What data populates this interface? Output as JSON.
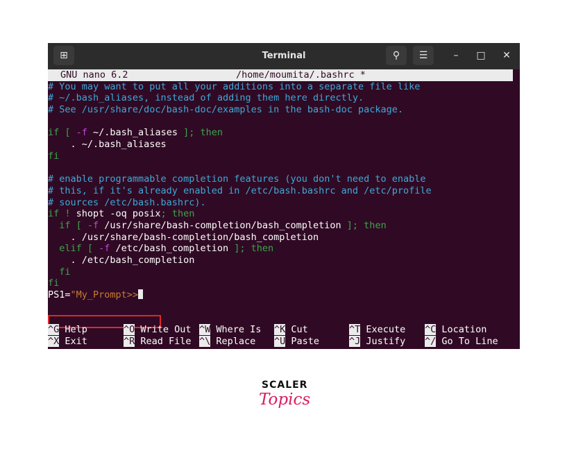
{
  "window": {
    "title": "Terminal",
    "icons": {
      "new_tab": "new-tab-icon",
      "search": "search-icon",
      "menu": "hamburger-menu-icon",
      "minimize": "minimize-icon",
      "maximize": "maximize-icon",
      "close": "close-icon"
    },
    "glyphs": {
      "new_tab": "⊞",
      "search": "⚲",
      "menu": "☰",
      "minimize": "–",
      "maximize": "□",
      "close": "✕"
    }
  },
  "nano": {
    "version": "GNU nano 6.2",
    "file": "/home/moumita/.bashrc *"
  },
  "editor": {
    "l1": "# You may want to put all your additions into a separate file like",
    "l2": "# ~/.bash_aliases, instead of adding them here directly.",
    "l3": "# See /usr/share/doc/bash-doc/examples in the bash-doc package.",
    "l5_if": "if [ ",
    "l5_flag": "-f",
    "l5_path": " ~/.bash_aliases",
    "l5_end": " ]; then",
    "l6": "    . ~/.bash_aliases",
    "l7": "fi",
    "l9": "# enable programmable completion features (you don't need to enable",
    "l10": "# this, if it's already enabled in /etc/bash.bashrc and /etc/profile",
    "l11": "# sources /etc/bash.bashrc).",
    "l12_if": "if ! ",
    "l12_cmd": "shopt -oq posix",
    "l12_then": "; then",
    "l13_if": "  if [ ",
    "l13_flag": "-f",
    "l13_path": " /usr/share/bash-completion/bash_completion",
    "l13_end": " ]; then",
    "l14": "    . /usr/share/bash-completion/bash_completion",
    "l15_elif": "  elif [ ",
    "l15_flag": "-f",
    "l15_path": " /etc/bash_completion",
    "l15_end": " ]; then",
    "l16": "    . /etc/bash_completion",
    "l17": "  fi",
    "l18": "fi",
    "ps1_var": "PS1",
    "ps1_eq": "=",
    "ps1_val": "\"My_Prompt>>"
  },
  "shortcuts": {
    "row1": [
      {
        "key": "^G",
        "label": " Help"
      },
      {
        "key": "^O",
        "label": " Write Out"
      },
      {
        "key": "^W",
        "label": " Where Is"
      },
      {
        "key": "^K",
        "label": " Cut"
      },
      {
        "key": "^T",
        "label": " Execute"
      },
      {
        "key": "^C",
        "label": " Location"
      }
    ],
    "row2": [
      {
        "key": "^X",
        "label": " Exit"
      },
      {
        "key": "^R",
        "label": " Read File"
      },
      {
        "key": "^\\",
        "label": " Replace"
      },
      {
        "key": "^U",
        "label": " Paste"
      },
      {
        "key": "^J",
        "label": " Justify"
      },
      {
        "key": "^/",
        "label": " Go To Line"
      }
    ]
  },
  "logo": {
    "top": "SCALER",
    "bottom": "Topics"
  }
}
